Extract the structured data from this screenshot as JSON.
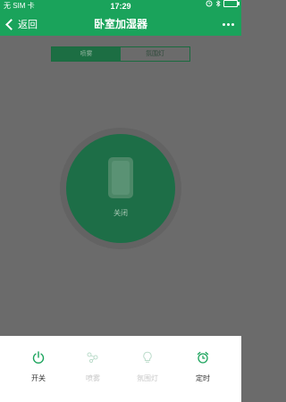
{
  "status_bar": {
    "carrier": "无 SIM 卡",
    "time": "17:29"
  },
  "nav": {
    "back_label": "返回",
    "title": "卧室加湿器"
  },
  "segment": {
    "tabs": [
      {
        "label": "喷雾",
        "active": true
      },
      {
        "label": "氛围灯",
        "active": false
      }
    ]
  },
  "power": {
    "status_label": "关闭"
  },
  "bottom_bar": {
    "buttons": [
      {
        "label": "开关",
        "icon": "power-icon",
        "enabled": true
      },
      {
        "label": "喷雾",
        "icon": "spray-icon",
        "enabled": false
      },
      {
        "label": "氛围灯",
        "icon": "lightbulb-icon",
        "enabled": false
      },
      {
        "label": "定时",
        "icon": "alarm-clock-icon",
        "enabled": true
      }
    ]
  },
  "colors": {
    "accent": "#1aa35b",
    "overlay": "#6b6b6b",
    "power_circle": "#1d6e47"
  }
}
